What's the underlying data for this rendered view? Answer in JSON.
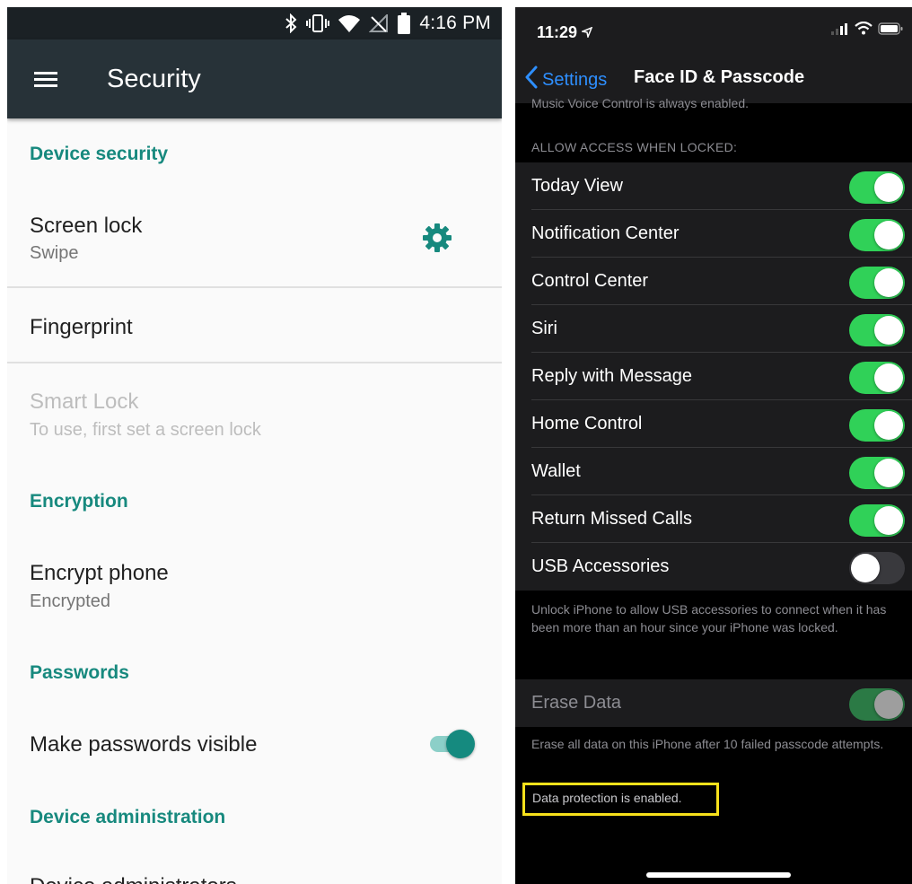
{
  "android": {
    "status_bar": {
      "time": "4:16 PM"
    },
    "toolbar": {
      "title": "Security"
    },
    "sections": {
      "device_security": "Device security",
      "encryption": "Encryption",
      "passwords": "Passwords",
      "device_administration": "Device administration"
    },
    "items": {
      "screen_lock": {
        "title": "Screen lock",
        "summary": "Swipe"
      },
      "fingerprint": {
        "title": "Fingerprint"
      },
      "smart_lock": {
        "title": "Smart Lock",
        "summary": "To use, first set a screen lock"
      },
      "encrypt_phone": {
        "title": "Encrypt phone",
        "summary": "Encrypted"
      },
      "make_passwords_visible": {
        "title": "Make passwords visible",
        "enabled": true
      },
      "device_administrators": {
        "title": "Device administrators"
      }
    },
    "colors": {
      "accent": "#17897e",
      "toolbar": "#273238",
      "status_bar": "#1b2125"
    }
  },
  "ios": {
    "status_bar": {
      "time": "11:29"
    },
    "nav": {
      "back_label": "Settings",
      "title": "Face ID & Passcode"
    },
    "clipped_text": "Music Voice Control is always enabled.",
    "section_header": "ALLOW ACCESS WHEN LOCKED:",
    "access_items": [
      {
        "label": "Today View",
        "on": true
      },
      {
        "label": "Notification Center",
        "on": true
      },
      {
        "label": "Control Center",
        "on": true
      },
      {
        "label": "Siri",
        "on": true
      },
      {
        "label": "Reply with Message",
        "on": true
      },
      {
        "label": "Home Control",
        "on": true
      },
      {
        "label": "Wallet",
        "on": true
      },
      {
        "label": "Return Missed Calls",
        "on": true
      },
      {
        "label": "USB Accessories",
        "on": false
      }
    ],
    "usb_footer": "Unlock iPhone to allow USB accessories to connect when it has been more than an hour since your iPhone was locked.",
    "erase_data": {
      "label": "Erase Data",
      "on": true
    },
    "erase_footer": "Erase all data on this iPhone after 10 failed passcode attempts.",
    "data_protection": "Data protection is enabled.",
    "colors": {
      "toggle_on": "#30d158",
      "link": "#2e8fff",
      "highlight": "#f7e11b"
    }
  }
}
